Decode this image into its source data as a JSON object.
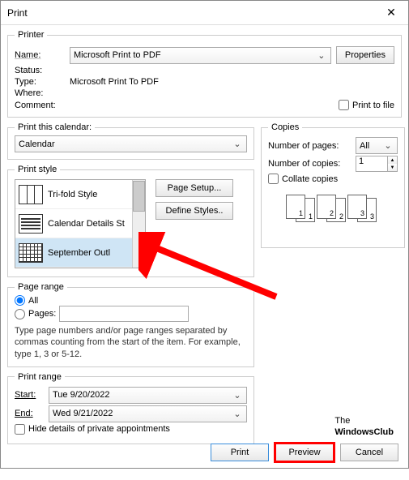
{
  "window": {
    "title": "Print"
  },
  "printer": {
    "legend": "Printer",
    "name_label": "Name:",
    "name_value": "Microsoft Print to PDF",
    "properties": "Properties",
    "status_label": "Status:",
    "status_value": "",
    "type_label": "Type:",
    "type_value": "Microsoft Print To PDF",
    "where_label": "Where:",
    "where_value": "",
    "comment_label": "Comment:",
    "comment_value": "",
    "print_to_file": "Print to file"
  },
  "calendar": {
    "legend": "Print this calendar:",
    "value": "Calendar"
  },
  "style": {
    "legend": "Print style",
    "items": [
      "Tri-fold Style",
      "Calendar Details St",
      "September Outl"
    ],
    "page_setup": "Page Setup...",
    "define_styles": "Define Styles.."
  },
  "page_range": {
    "legend": "Page range",
    "all": "All",
    "pages": "Pages:",
    "hint": "Type page numbers and/or page ranges separated by commas counting from the start of the item.  For example, type 1, 3 or 5-12."
  },
  "print_range": {
    "legend": "Print range",
    "start_label": "Start:",
    "start_value": "Tue 9/20/2022",
    "end_label": "End:",
    "end_value": "Wed 9/21/2022",
    "hide_details": "Hide details of private appointments"
  },
  "copies": {
    "legend": "Copies",
    "num_pages_label": "Number of pages:",
    "num_pages_value": "All",
    "num_copies_label": "Number of copies:",
    "num_copies_value": "1",
    "collate": "Collate copies"
  },
  "footer": {
    "print": "Print",
    "preview": "Preview",
    "cancel": "Cancel"
  },
  "logo": {
    "line1": "The",
    "line2": "WindowsClub"
  }
}
